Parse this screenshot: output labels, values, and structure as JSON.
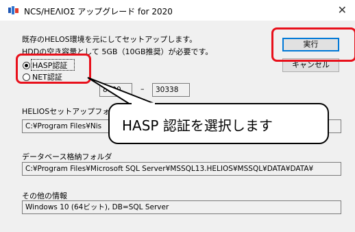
{
  "window": {
    "title": "NCS/HEΛIOΣ アップグレード for 2020",
    "close_glyph": "✕"
  },
  "intro": {
    "line1": "既存のHELOS環境を元にしてセットアップします。",
    "line2": "HDDの空き容量として 5GB（10GB推奨）が必要です。"
  },
  "buttons": {
    "run": "実行",
    "cancel": "キャンセル"
  },
  "auth": {
    "hasp_label": "HASP認証",
    "net_label": "NET認証",
    "hasp_selected": true,
    "port_from": "8000",
    "port_separator": "–",
    "port_to": "30338"
  },
  "setup_folder": {
    "label": "HELIOSセットアップフォル",
    "value": "C:¥Program Files¥Nis"
  },
  "db_folder": {
    "label": "データベース格納フォルダ",
    "value": "C:¥Program Files¥Microsoft SQL Server¥MSSQL13.HELIOS¥MSSQL¥DATA¥DATA¥"
  },
  "other_info": {
    "label": "その他の情報",
    "value": "Windows 10 (64ビット), DB=SQL Server"
  },
  "callout": {
    "text": "HASP 認証を選択します"
  },
  "colors": {
    "highlight": "#e8101b",
    "default_button_border": "#0078d7"
  }
}
